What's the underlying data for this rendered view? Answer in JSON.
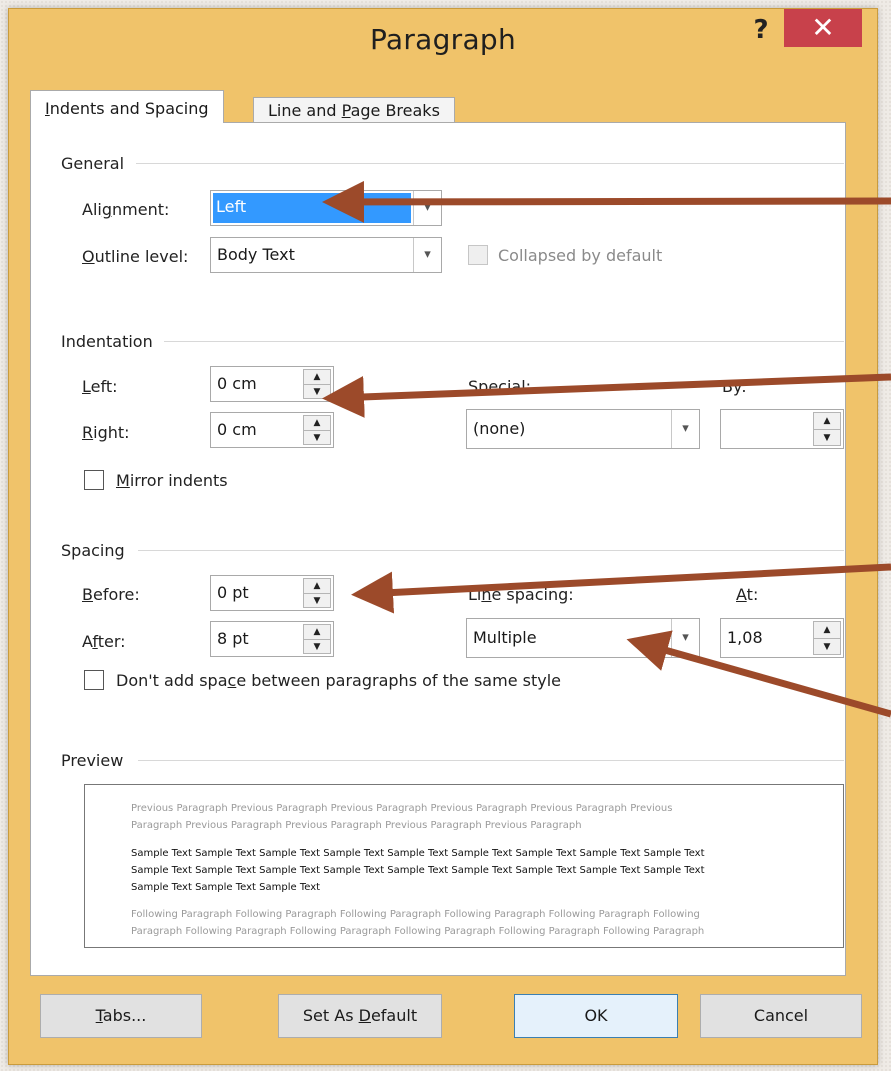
{
  "dialog": {
    "title": "Paragraph",
    "help_glyph": "?",
    "close_glyph": "✕"
  },
  "tabs": [
    {
      "label": "Indents and Spacing",
      "accel": "I",
      "rest": "ndents and Spacing"
    },
    {
      "label": "Line and Page Breaks",
      "pre": "Line and ",
      "accel": "P",
      "rest": "age Breaks"
    }
  ],
  "general": {
    "heading": "General",
    "alignment_label_pre": "Ali",
    "alignment_label_accel": "g",
    "alignment_label_rest": "nment:",
    "alignment_value": "Left",
    "outline_label_accel": "O",
    "outline_label_rest": "utline level:",
    "outline_value": "Body Text",
    "collapsed_label": "Collapsed by default"
  },
  "indentation": {
    "heading": "Indentation",
    "left_label_accel": "L",
    "left_label_rest": "eft:",
    "left_value": "0 cm",
    "right_label_accel": "R",
    "right_label_rest": "ight:",
    "right_value": "0 cm",
    "special_label": "Special:",
    "special_value": "(none)",
    "by_label": "By:",
    "by_value": "",
    "mirror_label_accel": "M",
    "mirror_label_rest": "irror indents"
  },
  "spacing": {
    "heading": "Spacing",
    "before_label_accel": "B",
    "before_label_rest": "efore:",
    "before_value": "0 pt",
    "after_label_pre": "A",
    "after_label_accel": "f",
    "after_label_rest": "ter:",
    "after_value": "8 pt",
    "line_spacing_label_pre": "Li",
    "line_spacing_label_accel": "n",
    "line_spacing_label_rest": "e spacing:",
    "line_spacing_value": "Multiple",
    "at_label_accel": "A",
    "at_label_rest": "t:",
    "at_value": "1,08",
    "dont_add_pre": "Don't add spa",
    "dont_add_accel": "c",
    "dont_add_rest": "e between paragraphs of the same style"
  },
  "preview": {
    "heading": "Preview",
    "prev_line1": "Previous Paragraph Previous Paragraph Previous Paragraph Previous Paragraph Previous Paragraph Previous",
    "prev_line2": "Paragraph Previous Paragraph Previous Paragraph Previous Paragraph Previous Paragraph",
    "sample_line1": "Sample Text Sample Text Sample Text Sample Text Sample Text Sample Text Sample Text Sample Text Sample Text",
    "sample_line2": "Sample Text Sample Text Sample Text Sample Text Sample Text Sample Text Sample Text Sample Text Sample Text",
    "sample_line3": "Sample Text Sample Text Sample Text",
    "follow_line1": "Following Paragraph Following Paragraph Following Paragraph Following Paragraph Following Paragraph Following",
    "follow_line2": "Paragraph Following Paragraph Following Paragraph Following Paragraph Following Paragraph Following Paragraph"
  },
  "buttons": {
    "tabs_accel": "T",
    "tabs_rest": "abs...",
    "default_pre": "Set As ",
    "default_accel": "D",
    "default_rest": "efault",
    "ok": "OK",
    "cancel": "Cancel"
  },
  "colors": {
    "title_bar": "#f0c36a",
    "close_button": "#c8414b",
    "selection": "#3399ff",
    "annotation_arrow": "#9c4a2a"
  }
}
